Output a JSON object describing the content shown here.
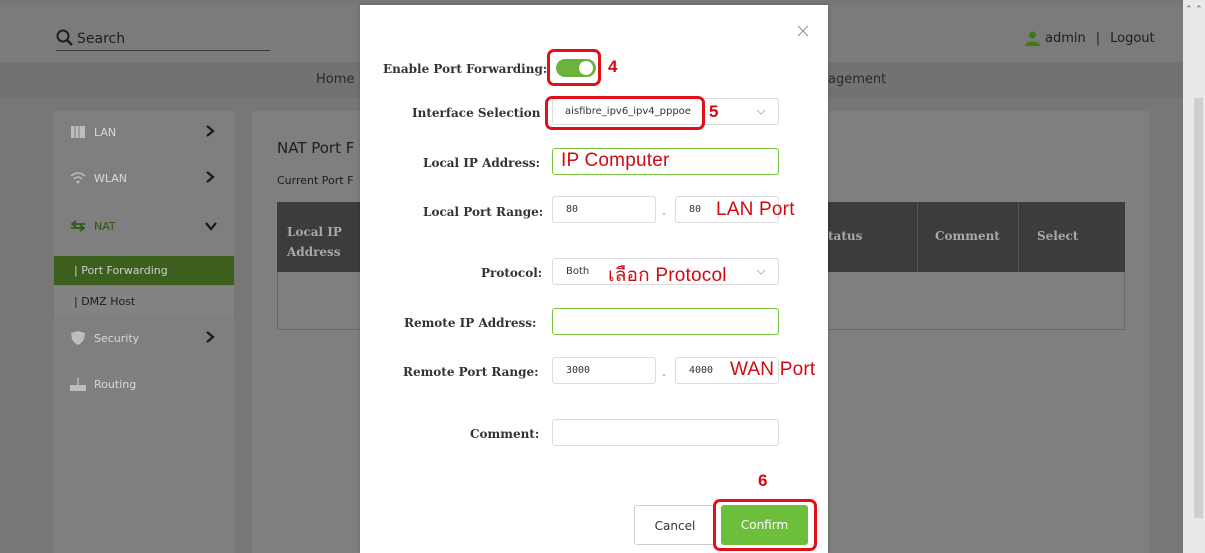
{
  "header": {
    "search_placeholder": "Search",
    "user": "admin",
    "separator": "|",
    "logout": "Logout"
  },
  "nav": {
    "home": "Home",
    "management": "agement"
  },
  "sidebar": {
    "items": [
      {
        "label": "LAN",
        "icon": "lan-icon"
      },
      {
        "label": "WLAN",
        "icon": "wifi-icon"
      },
      {
        "label": "NAT",
        "icon": "nat-icon"
      },
      {
        "label": "Security",
        "icon": "shield-icon"
      },
      {
        "label": "Routing",
        "icon": "router-icon"
      }
    ],
    "subitems": [
      {
        "label": "| Port Forwarding",
        "active": true
      },
      {
        "label": "| DMZ Host",
        "active": false
      }
    ]
  },
  "content": {
    "title": "NAT Port F",
    "subtitle": "Current Port F",
    "columns": [
      "Local IP Address",
      "tatus",
      "Comment",
      "Select"
    ]
  },
  "modal": {
    "enable_label": "Enable Port Forwarding:",
    "enable_on": true,
    "interface_label": "Interface Selection",
    "interface_value": "aisfibre_ipv6_ipv4_pppoe",
    "local_ip_label": "Local IP Address:",
    "local_ip_value": "",
    "local_port_label": "Local Port Range:",
    "local_port_from": "80",
    "local_port_to": "80",
    "range_dash": "-",
    "protocol_label": "Protocol:",
    "protocol_value": "Both",
    "remote_ip_label": "Remote IP Address:",
    "remote_ip_value": "",
    "remote_port_label": "Remote Port Range:",
    "remote_port_from": "3000",
    "remote_port_to": "4000",
    "comment_label": "Comment:",
    "comment_value": "",
    "cancel": "Cancel",
    "confirm": "Confirm"
  },
  "annotations": {
    "step4": "4",
    "step5": "5",
    "step6": "6",
    "ip_computer": "IP Computer",
    "lan_port": "LAN Port",
    "select_protocol": "เลือก Protocol",
    "wan_port": "WAN Port"
  },
  "colors": {
    "accent_green": "#6cbf3a",
    "annotation_red": "#e0101a",
    "overlay_gray": "#777777"
  }
}
